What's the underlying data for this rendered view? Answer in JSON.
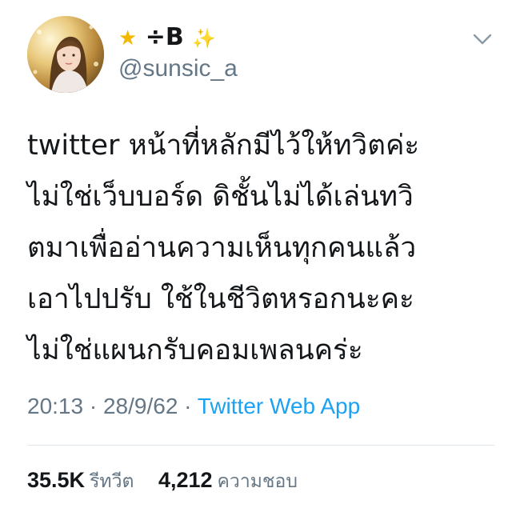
{
  "author": {
    "display_name_prefix_icon": "star-icon",
    "display_name": "÷B",
    "display_name_suffix_icon": "sparkles-icon",
    "handle": "@sunsic_a",
    "avatar_icon": "avatar-photo"
  },
  "menu_icon": "chevron-down-icon",
  "tweet": {
    "lines": [
      "twitter หน้าที่หลักมีไว้ให้ทวิตค่ะ",
      "ไม่ใช่เว็บบอร์ด ดิชั้นไม่ได้เล่นทวิ",
      "ตมาเพื่ออ่านความเห็นทุกคนแล้ว",
      "เอาไปปรับ ใช้ในชีวิตหรอกนะคะ",
      "ไม่ใช่แผนกรับคอมเพลนคร่ะ"
    ]
  },
  "meta": {
    "time": "20:13",
    "separator": "·",
    "date": "28/9/62",
    "source": "Twitter Web App"
  },
  "stats": {
    "retweets_count": "35.5K",
    "retweets_label": "รีทวีต",
    "likes_count": "4,212",
    "likes_label": "ความชอบ"
  },
  "colors": {
    "text": "#14171a",
    "secondary": "#657786",
    "link": "#1da1f2",
    "divider": "#e1e8ed"
  }
}
